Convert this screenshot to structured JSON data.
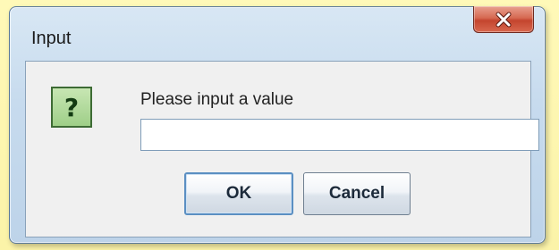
{
  "dialog": {
    "title": "Input",
    "message": "Please input a value",
    "input": {
      "value": "",
      "placeholder": ""
    },
    "buttons": {
      "ok_label": "OK",
      "cancel_label": "Cancel"
    },
    "icon": {
      "name": "question-icon",
      "glyph": "?"
    },
    "close_icon": "close-icon"
  },
  "colors": {
    "desktop_background": "#fbf6b4",
    "frame": "#c7dbee",
    "close_button": "#c4452e",
    "question_icon_fill": "#9fcf88",
    "default_button_border": "#5b8fc2"
  }
}
